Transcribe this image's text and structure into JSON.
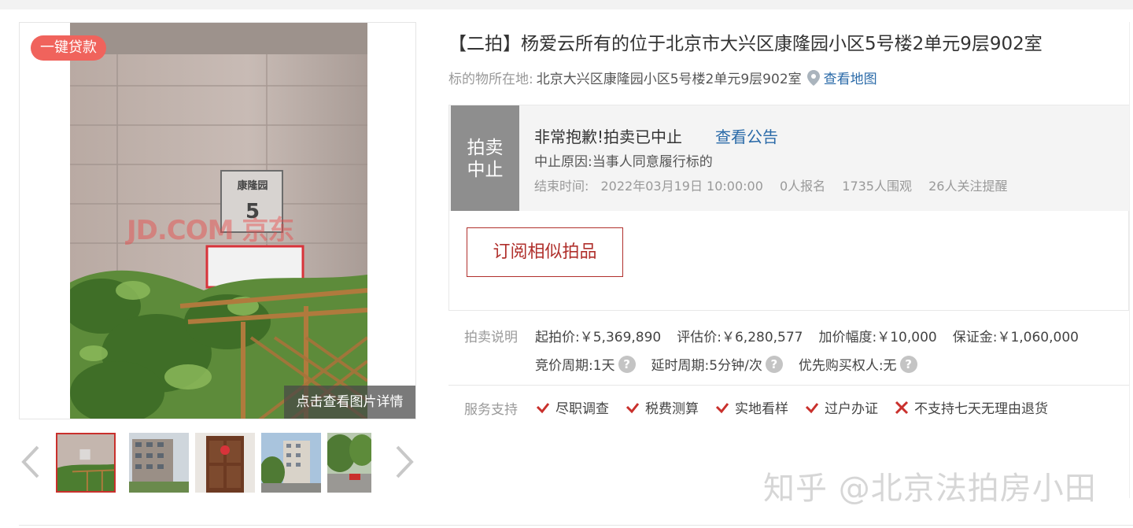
{
  "title": "【二拍】杨爱云所有的位于北京市大兴区康隆园小区5号楼2单元9层902室",
  "location": {
    "label": "标的物所在地:",
    "address": "北京大兴区康隆园小区5号楼2单元9层902室",
    "map_link": "查看地图"
  },
  "gallery": {
    "loan_badge": "一键贷款",
    "view_detail": "点击查看图片详情",
    "image_watermark": "JD.COM 京东",
    "sign_text": "康隆园",
    "sign_number": "5",
    "thumbnail_count": 5,
    "active_thumbnail": 1
  },
  "status": {
    "badge_line1": "拍卖",
    "badge_line2": "中止",
    "message": "非常抱歉!拍卖已中止",
    "notice_link": "查看公告",
    "reason": "中止原因:当事人同意履行标的",
    "end_time_label": "结束时间:",
    "end_time": "2022年03月19日 10:00:00",
    "signups": "0人报名",
    "watchers": "1735人围观",
    "followers": "26人关注提醒"
  },
  "subscribe_button": "订阅相似拍品",
  "auction_info": {
    "label": "拍卖说明",
    "starting_price": "起拍价:￥5,369,890",
    "appraised_price": "评估价:￥6,280,577",
    "increment": "加价幅度:￥10,000",
    "deposit": "保证金:￥1,060,000",
    "bidding_period": "竞价周期:1天",
    "extension_period": "延时周期:5分钟/次",
    "priority_buyer": "优先购买权人:无"
  },
  "services": {
    "label": "服务支持",
    "items": [
      {
        "text": "尽职调查",
        "supported": true
      },
      {
        "text": "税费测算",
        "supported": true
      },
      {
        "text": "实地看样",
        "supported": true
      },
      {
        "text": "过户办证",
        "supported": true
      },
      {
        "text": "不支持七天无理由退货",
        "supported": false
      }
    ]
  },
  "watermark": "知乎 @北京法拍房小田",
  "colors": {
    "accent_red": "#c9302c",
    "badge_red": "#f0635c",
    "link_blue": "#2a6aa8",
    "status_gray": "#8e8e8e"
  }
}
